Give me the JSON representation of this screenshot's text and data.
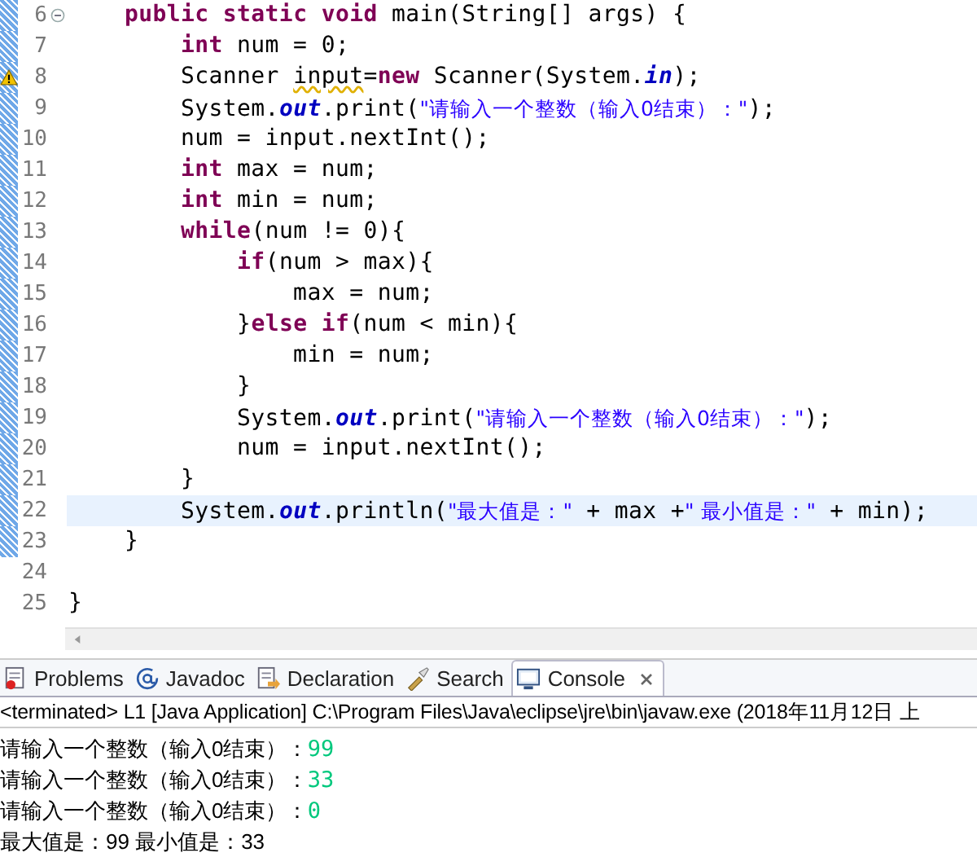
{
  "editor": {
    "lines": [
      {
        "number": "6",
        "fold": true,
        "warning": false,
        "current": false,
        "scope": true,
        "tokens": [
          {
            "kind": "kw",
            "text": "    public "
          },
          {
            "kind": "kw",
            "text": "static "
          },
          {
            "kind": "kw",
            "text": "void "
          },
          {
            "kind": "txt",
            "text": "main(String[] args) {"
          }
        ]
      },
      {
        "number": "7",
        "fold": false,
        "warning": false,
        "current": false,
        "scope": true,
        "tokens": [
          {
            "kind": "kw",
            "text": "        int "
          },
          {
            "kind": "txt",
            "text": "num = 0;"
          }
        ]
      },
      {
        "number": "8",
        "fold": false,
        "warning": true,
        "current": false,
        "scope": true,
        "tokens": [
          {
            "kind": "txt",
            "text": "        Scanner "
          },
          {
            "kind": "warn",
            "text": "input"
          },
          {
            "kind": "txt",
            "text": "="
          },
          {
            "kind": "kw",
            "text": "new"
          },
          {
            "kind": "txt",
            "text": " Scanner(System."
          },
          {
            "kind": "field",
            "text": "in"
          },
          {
            "kind": "txt",
            "text": ");"
          }
        ]
      },
      {
        "number": "9",
        "fold": false,
        "warning": false,
        "current": false,
        "scope": true,
        "tokens": [
          {
            "kind": "txt",
            "text": "        System."
          },
          {
            "kind": "field",
            "text": "out"
          },
          {
            "kind": "txt",
            "text": ".print("
          },
          {
            "kind": "str",
            "text": "\"请输入一个整数（输入0结束）：\""
          },
          {
            "kind": "txt",
            "text": ");"
          }
        ]
      },
      {
        "number": "10",
        "fold": false,
        "warning": false,
        "current": false,
        "scope": true,
        "tokens": [
          {
            "kind": "txt",
            "text": "        num = input.nextInt();"
          }
        ]
      },
      {
        "number": "11",
        "fold": false,
        "warning": false,
        "current": false,
        "scope": true,
        "tokens": [
          {
            "kind": "kw",
            "text": "        int "
          },
          {
            "kind": "txt",
            "text": "max = num;"
          }
        ]
      },
      {
        "number": "12",
        "fold": false,
        "warning": false,
        "current": false,
        "scope": true,
        "tokens": [
          {
            "kind": "kw",
            "text": "        int "
          },
          {
            "kind": "txt",
            "text": "min = num;"
          }
        ]
      },
      {
        "number": "13",
        "fold": false,
        "warning": false,
        "current": false,
        "scope": true,
        "tokens": [
          {
            "kind": "kw",
            "text": "        while"
          },
          {
            "kind": "txt",
            "text": "(num != 0){"
          }
        ]
      },
      {
        "number": "14",
        "fold": false,
        "warning": false,
        "current": false,
        "scope": true,
        "tokens": [
          {
            "kind": "kw",
            "text": "            if"
          },
          {
            "kind": "txt",
            "text": "(num > max){"
          }
        ]
      },
      {
        "number": "15",
        "fold": false,
        "warning": false,
        "current": false,
        "scope": true,
        "tokens": [
          {
            "kind": "txt",
            "text": "                max = num;"
          }
        ]
      },
      {
        "number": "16",
        "fold": false,
        "warning": false,
        "current": false,
        "scope": true,
        "tokens": [
          {
            "kind": "txt",
            "text": "            }"
          },
          {
            "kind": "kw",
            "text": "else if"
          },
          {
            "kind": "txt",
            "text": "(num < min){"
          }
        ]
      },
      {
        "number": "17",
        "fold": false,
        "warning": false,
        "current": false,
        "scope": true,
        "tokens": [
          {
            "kind": "txt",
            "text": "                min = num;"
          }
        ]
      },
      {
        "number": "18",
        "fold": false,
        "warning": false,
        "current": false,
        "scope": true,
        "tokens": [
          {
            "kind": "txt",
            "text": "            }"
          }
        ]
      },
      {
        "number": "19",
        "fold": false,
        "warning": false,
        "current": false,
        "scope": true,
        "tokens": [
          {
            "kind": "txt",
            "text": "            System."
          },
          {
            "kind": "field",
            "text": "out"
          },
          {
            "kind": "txt",
            "text": ".print("
          },
          {
            "kind": "str",
            "text": "\"请输入一个整数（输入0结束）：\""
          },
          {
            "kind": "txt",
            "text": ");"
          }
        ]
      },
      {
        "number": "20",
        "fold": false,
        "warning": false,
        "current": false,
        "scope": true,
        "tokens": [
          {
            "kind": "txt",
            "text": "            num = input.nextInt();"
          }
        ]
      },
      {
        "number": "21",
        "fold": false,
        "warning": false,
        "current": false,
        "scope": true,
        "tokens": [
          {
            "kind": "txt",
            "text": "        }"
          }
        ]
      },
      {
        "number": "22",
        "fold": false,
        "warning": false,
        "current": true,
        "scope": true,
        "tokens": [
          {
            "kind": "txt",
            "text": "        System."
          },
          {
            "kind": "field",
            "text": "out"
          },
          {
            "kind": "txt",
            "text": ".println("
          },
          {
            "kind": "str",
            "text": "\"最大值是：\""
          },
          {
            "kind": "txt",
            "text": " + max +"
          },
          {
            "kind": "str",
            "text": "\" 最小值是：\""
          },
          {
            "kind": "txt",
            "text": " + min);"
          }
        ]
      },
      {
        "number": "23",
        "fold": false,
        "warning": false,
        "current": false,
        "scope": true,
        "tokens": [
          {
            "kind": "txt",
            "text": "    }"
          }
        ]
      },
      {
        "number": "24",
        "fold": false,
        "warning": false,
        "current": false,
        "scope": false
      },
      {
        "number": "25",
        "fold": false,
        "warning": false,
        "current": false,
        "scope": false,
        "tokens": [
          {
            "kind": "txt",
            "text": "}"
          }
        ]
      }
    ]
  },
  "tabs": [
    {
      "label": "Problems",
      "selected": false,
      "closable": false
    },
    {
      "label": "Javadoc",
      "selected": false,
      "closable": false
    },
    {
      "label": "Declaration",
      "selected": false,
      "closable": false
    },
    {
      "label": "Search",
      "selected": false,
      "closable": false
    },
    {
      "label": "Console",
      "selected": true,
      "closable": true
    }
  ],
  "console": {
    "status": "<terminated> L1 [Java Application] C:\\Program Files\\Java\\eclipse\\jre\\bin\\javaw.exe (2018年11月12日 上",
    "lines": [
      {
        "text": "请输入一个整数（输入0结束）：",
        "input": "99"
      },
      {
        "text": "请输入一个整数（输入0结束）：",
        "input": "33"
      },
      {
        "text": "请输入一个整数（输入0结束）：",
        "input": "0"
      },
      {
        "text": "最大值是：99 最小值是：33"
      }
    ]
  }
}
